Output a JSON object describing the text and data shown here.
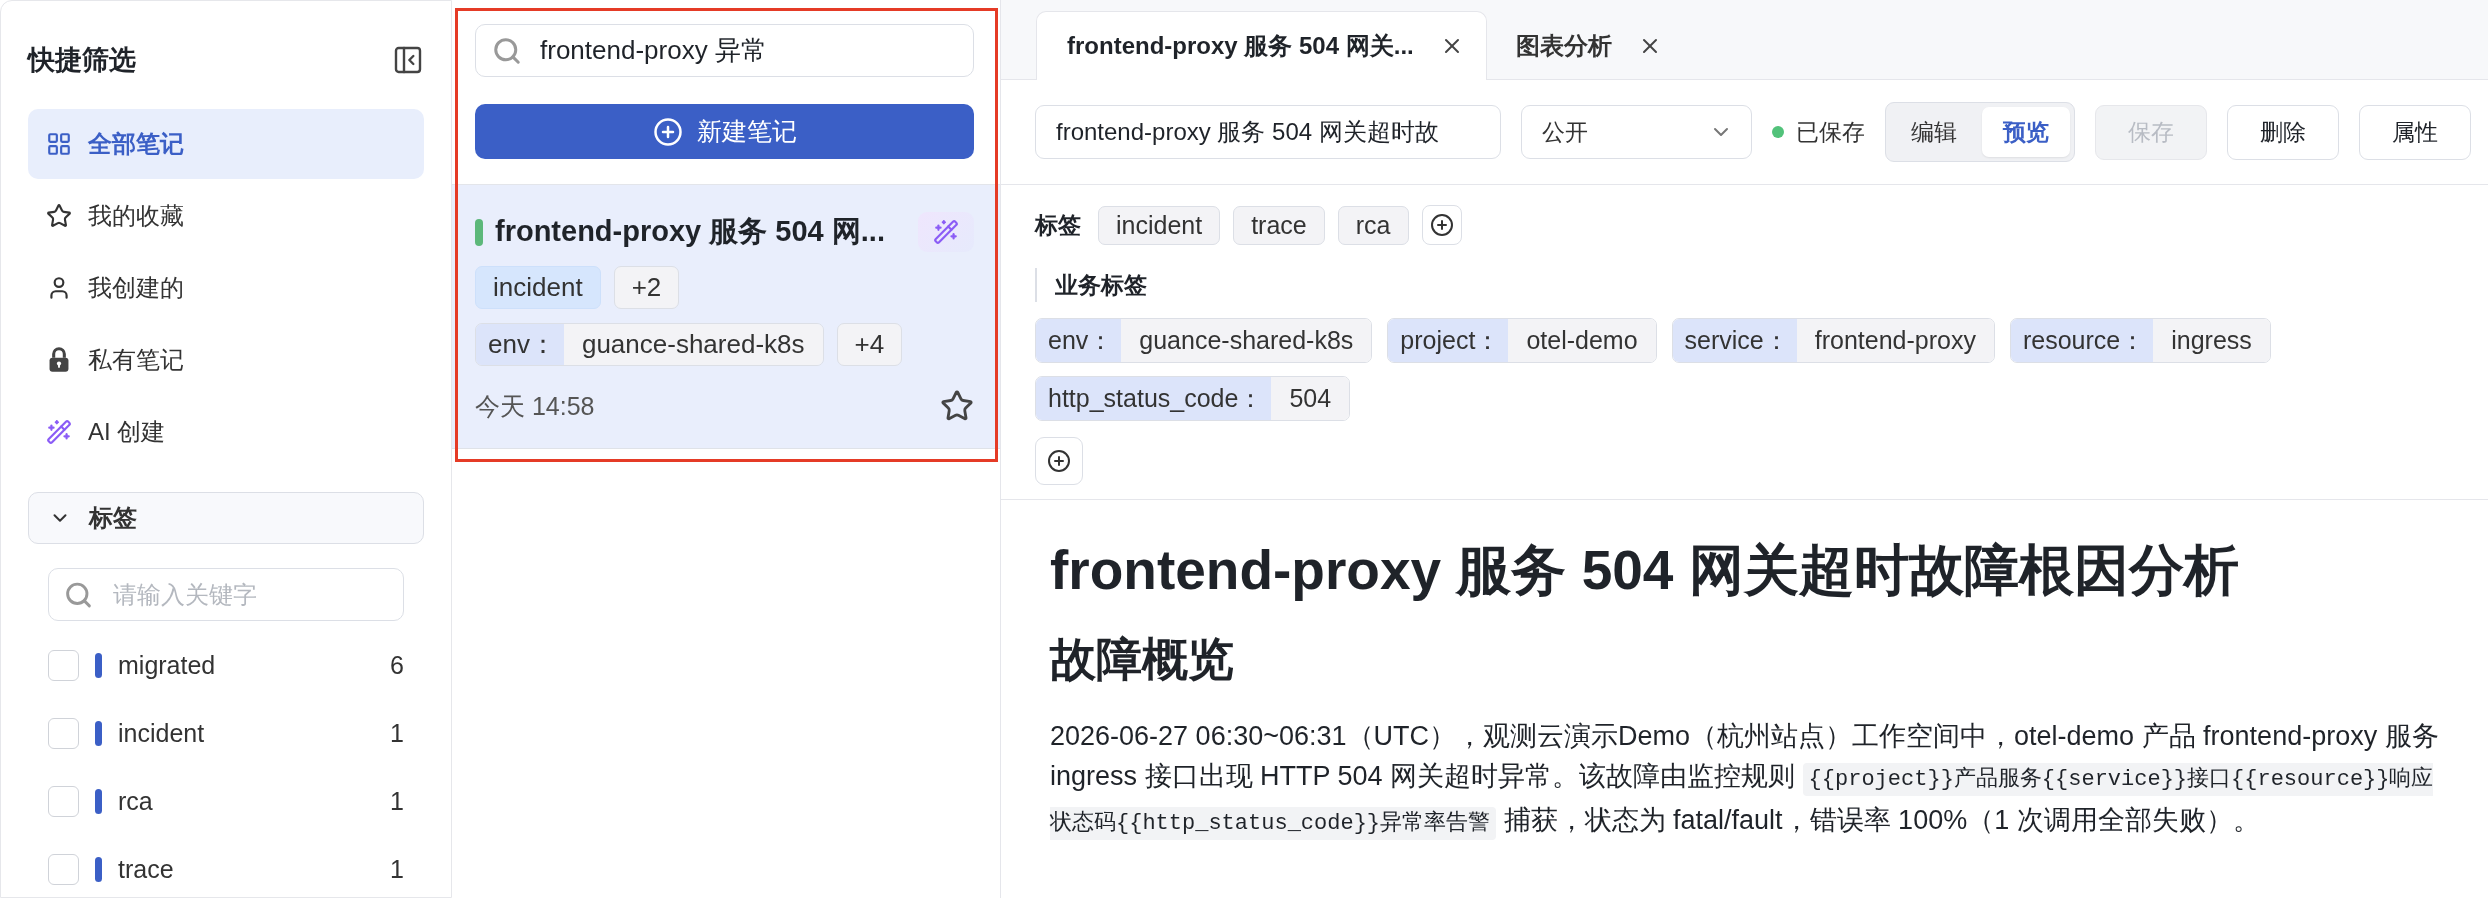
{
  "sidebar": {
    "title": "快捷筛选",
    "items": [
      {
        "label": "全部笔记",
        "selected": true
      },
      {
        "label": "我的收藏",
        "selected": false
      },
      {
        "label": "我创建的",
        "selected": false
      },
      {
        "label": "私有笔记",
        "selected": false
      },
      {
        "label": "AI 创建",
        "selected": false
      }
    ],
    "tag_section": {
      "title": "标签",
      "expanded": true,
      "search": {
        "placeholder": "请输入关键字"
      },
      "tags": [
        {
          "name": "migrated",
          "count": "6",
          "checked": false
        },
        {
          "name": "incident",
          "count": "1",
          "checked": false
        },
        {
          "name": "rca",
          "count": "1",
          "checked": false
        },
        {
          "name": "trace",
          "count": "1",
          "checked": false
        }
      ]
    }
  },
  "note_list": {
    "search": {
      "value": "frontend-proxy 异常"
    },
    "new_button": "新建笔记",
    "notes": [
      {
        "title": "frontend-proxy 服务 504 网...",
        "selected": true,
        "ai_generated": true,
        "tags": [
          "incident"
        ],
        "more_tags": "+2",
        "business_tags": [
          {
            "key": "env：",
            "value": "guance-shared-k8s"
          }
        ],
        "more_business_tags": "+4",
        "time": "今天 14:58",
        "starred": false
      }
    ]
  },
  "editor": {
    "tabs": [
      {
        "label": "frontend-proxy 服务 504 网关...",
        "selected": true
      },
      {
        "label": "图表分析",
        "selected": false
      }
    ],
    "toolbar": {
      "title_field": {
        "value": "frontend-proxy 服务 504 网关超时故"
      },
      "visibility_select": {
        "value": "公开"
      },
      "save_status": "已保存",
      "modes": [
        {
          "label": "编辑",
          "selected": false
        },
        {
          "label": "预览",
          "selected": true
        }
      ],
      "buttons": [
        {
          "label": "保存",
          "disabled": true
        },
        {
          "label": "删除",
          "disabled": false
        },
        {
          "label": "属性",
          "disabled": false
        }
      ]
    },
    "tags": {
      "label": "标签",
      "items": [
        "incident",
        "trace",
        "rca"
      ]
    },
    "business_tags": {
      "label": "业务标签",
      "items": [
        {
          "key": "env：",
          "value": "guance-shared-k8s"
        },
        {
          "key": "project：",
          "value": "otel-demo"
        },
        {
          "key": "service：",
          "value": "frontend-proxy"
        },
        {
          "key": "resource：",
          "value": "ingress"
        },
        {
          "key": "http_status_code：",
          "value": "504"
        }
      ]
    },
    "document": {
      "title": "frontend-proxy 服务 504 网关超时故障根因分析",
      "sections": [
        {
          "heading": "故障概览",
          "paragraph": [
            {
              "kind": "text",
              "text": "2026-06-27 06:30~06:31（UTC），观测云演示Demo（杭州站点）工作空间中，otel-demo 产品 frontend-proxy 服务 ingress 接口出现 HTTP 504 网关超时异常。该故障由监控规则 "
            },
            {
              "kind": "code",
              "text": "{{project}}产品服务{{service}}接口{{resource}}响应状态码{{http_status_code}}异常率告警"
            },
            {
              "kind": "text",
              "text": " 捕获，状态为 fatal/fault，错误率 100%（1 次调用全部失败）。"
            }
          ]
        }
      ]
    }
  }
}
